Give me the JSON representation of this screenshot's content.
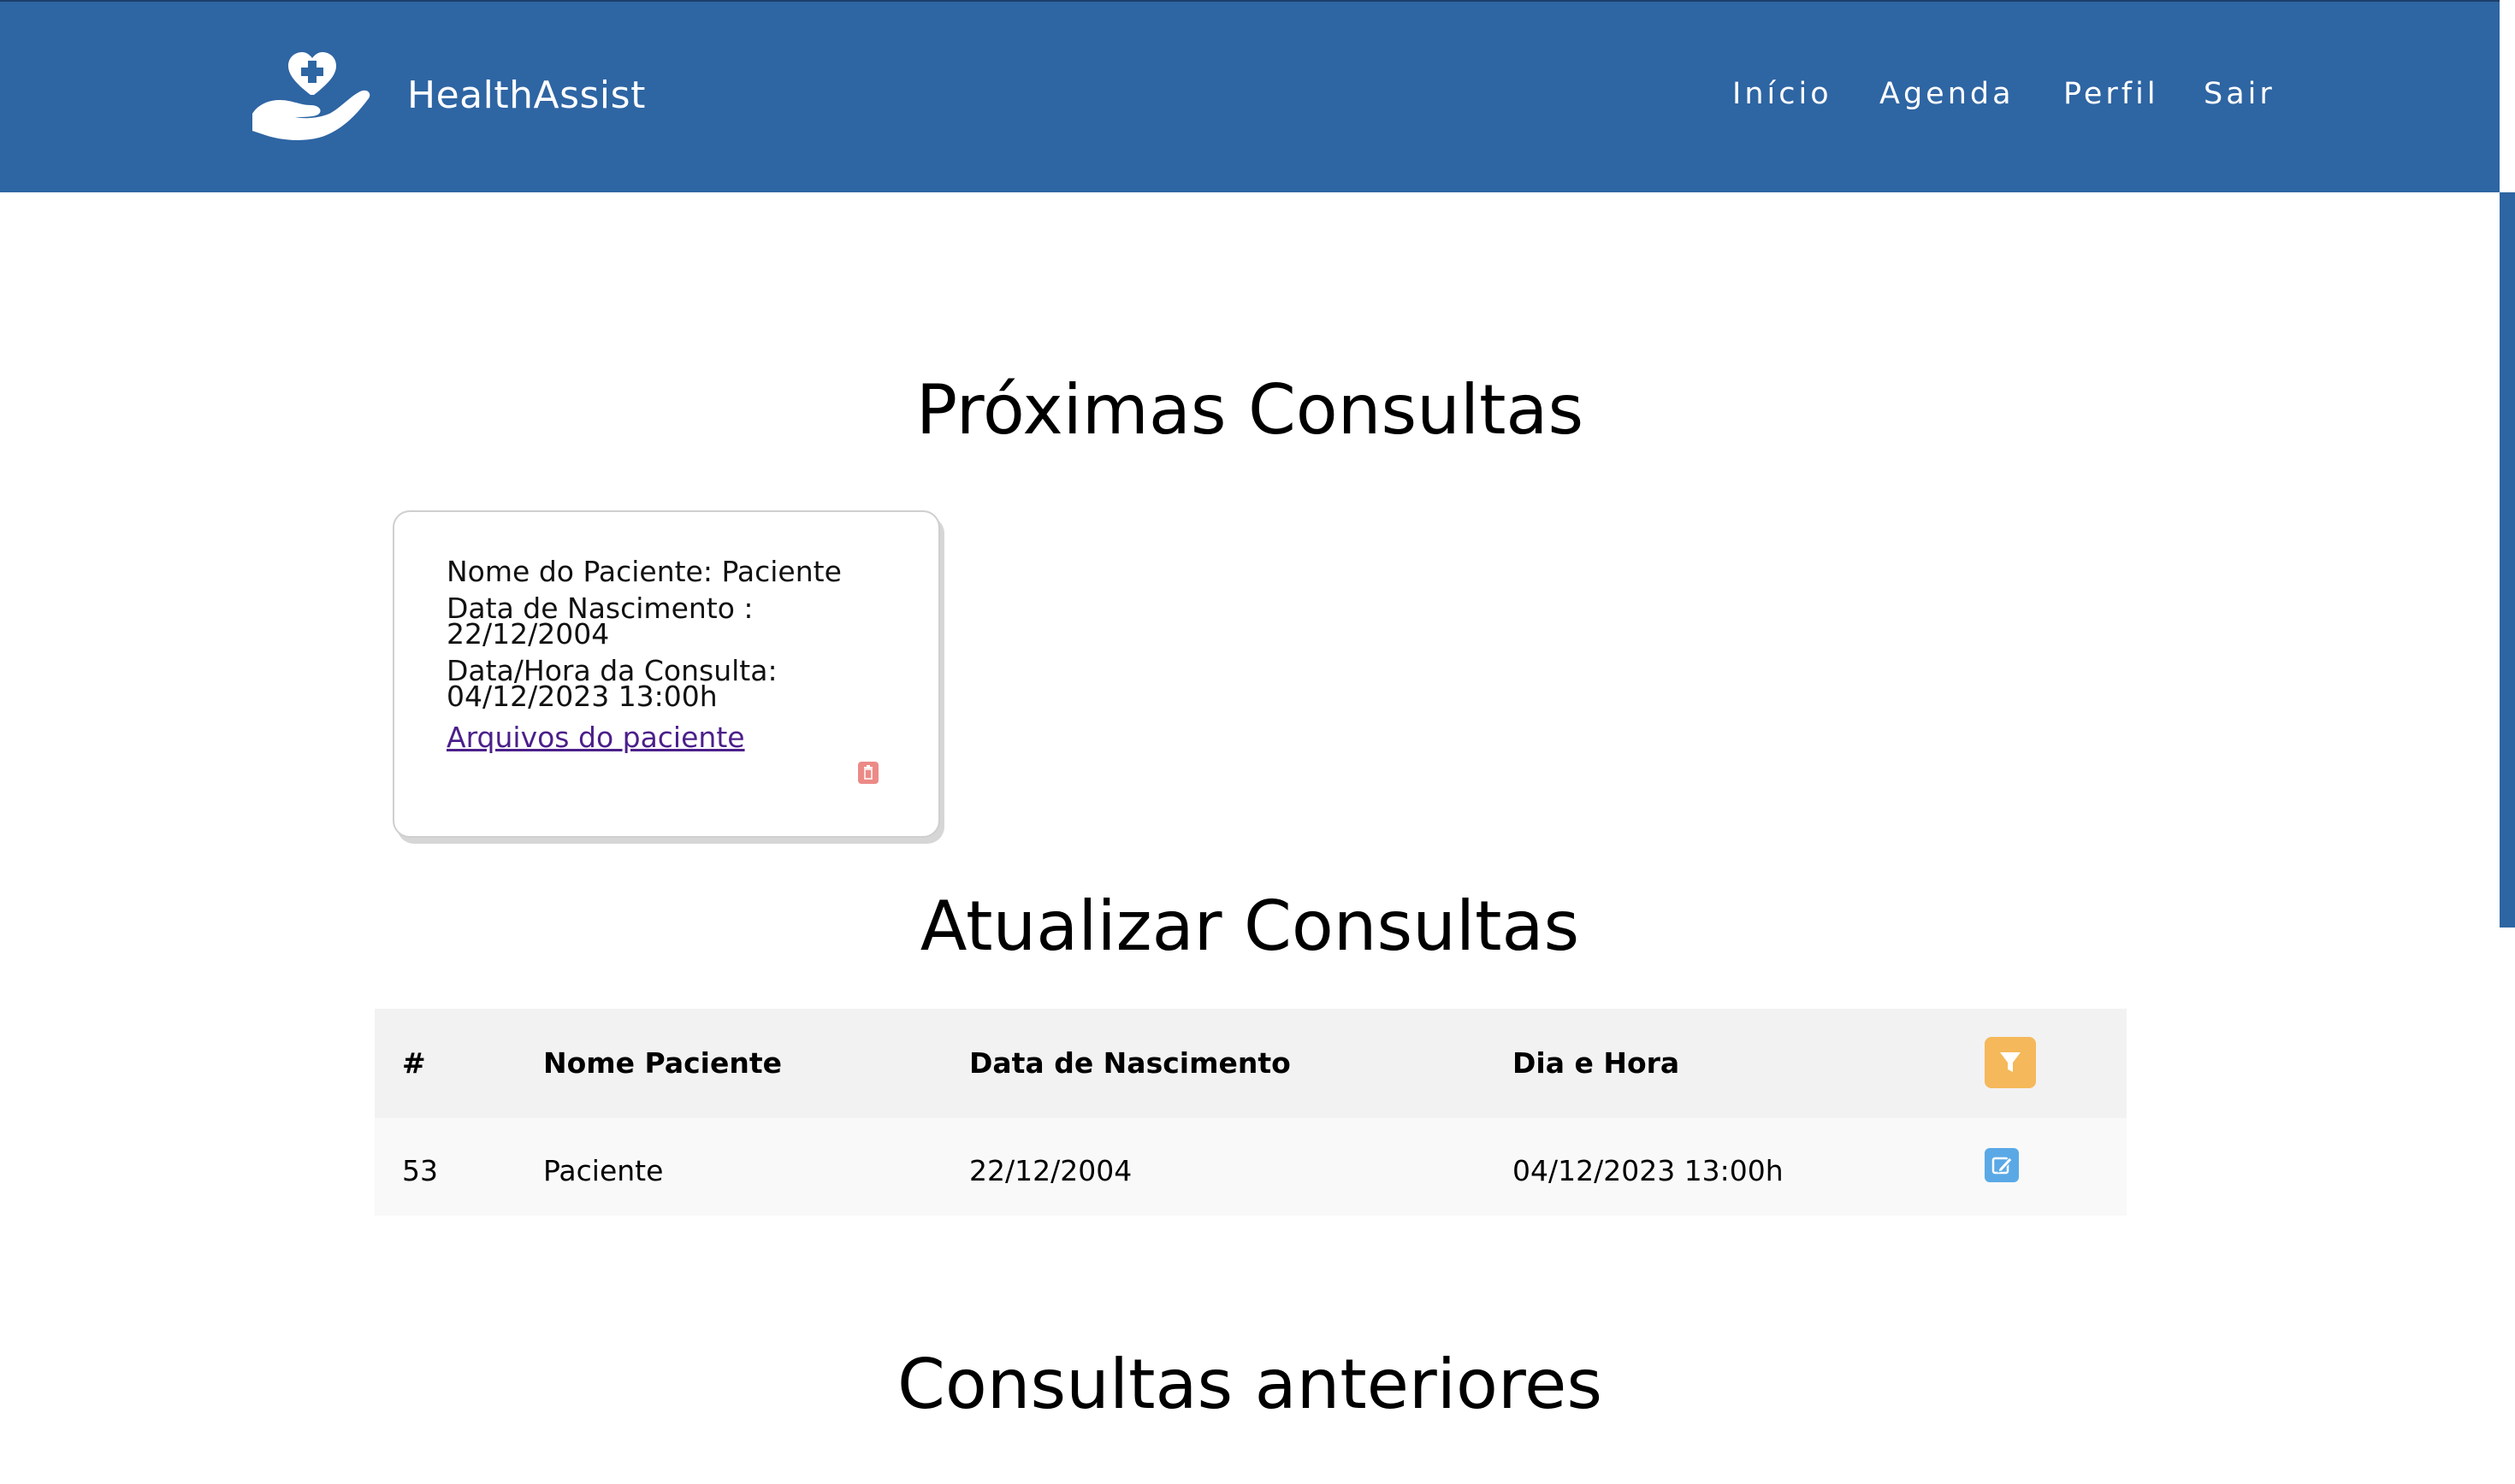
{
  "header": {
    "brand_name": "HealthAssist",
    "logo_icon": "hand-heart-icon",
    "nav": [
      "Início",
      "Agenda",
      "Perfil",
      "Sair"
    ],
    "bg_color": "#2e65a3"
  },
  "sections": {
    "upcoming_title": "Próximas Consultas",
    "update_title": "Atualizar Consultas",
    "previous_title": "Consultas anteriores"
  },
  "card": {
    "patient_name": "Nome do Paciente: Paciente",
    "birth_label": "Data de Nascimento :",
    "birth_value": "22/12/2004",
    "datetime_label": "Data/Hora da Consulta:",
    "datetime_value": "04/12/2023 13:00h",
    "files_link": "Arquivos do paciente",
    "delete_icon": "trash-icon",
    "delete_color": "#ec8a86"
  },
  "table": {
    "headers": [
      "#",
      "Nome Paciente",
      "Data de Nascimento",
      "Dia e Hora"
    ],
    "filter_icon": "filter-icon",
    "filter_color": "#f5b85a",
    "rows": [
      {
        "id": "53",
        "name": "Paciente",
        "birth": "22/12/2004",
        "datetime": "04/12/2023 13:00h",
        "edit_icon": "edit-icon"
      }
    ],
    "edit_color": "#5aa9e6"
  }
}
